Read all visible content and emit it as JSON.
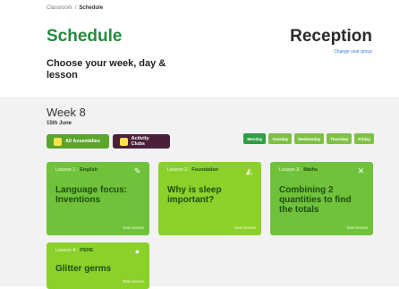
{
  "breadcrumb": {
    "parent": "Classroom",
    "current": "Schedule"
  },
  "header": {
    "title": "Schedule",
    "subtitle": "Choose your week, day & lesson",
    "year_group": "Reception",
    "change_year_group": "Change year group"
  },
  "week": {
    "title": "Week 8",
    "date": "15th June"
  },
  "filters": [
    {
      "label": "All Assemblies",
      "icon": "assembly-icon"
    },
    {
      "label": "Activity Clubs",
      "icon": "activity-club-icon"
    }
  ],
  "days": [
    {
      "label": "Monday",
      "active": true
    },
    {
      "label": "Tuesday",
      "active": false
    },
    {
      "label": "Wednesday",
      "active": false
    },
    {
      "label": "Thursday",
      "active": false
    },
    {
      "label": "Friday",
      "active": false
    }
  ],
  "lessons": [
    {
      "lesson": "Lesson 1",
      "subject": "English",
      "title": "Language focus: Inventions",
      "start": "Start lesson",
      "icon": "pencil-icon"
    },
    {
      "lesson": "Lesson 2",
      "subject": "Foundation",
      "title": "Why is sleep important?",
      "start": "Start lesson",
      "icon": "lamp-icon"
    },
    {
      "lesson": "Lesson 3",
      "subject": "Maths",
      "title": "Combining 2 quantities to find the totals",
      "start": "Start lesson",
      "icon": "compass-icon"
    },
    {
      "lesson": "Lesson 4",
      "subject": "PSHE",
      "title": "Glitter germs",
      "start": "Start lesson",
      "icon": "bulb-icon"
    }
  ],
  "colors": {
    "title_green": "#248a3d",
    "card_green": "#6fc239",
    "card_lime": "#8bd12a",
    "activity_purple": "#4a1f3a",
    "day_active": "#2f9e44"
  }
}
